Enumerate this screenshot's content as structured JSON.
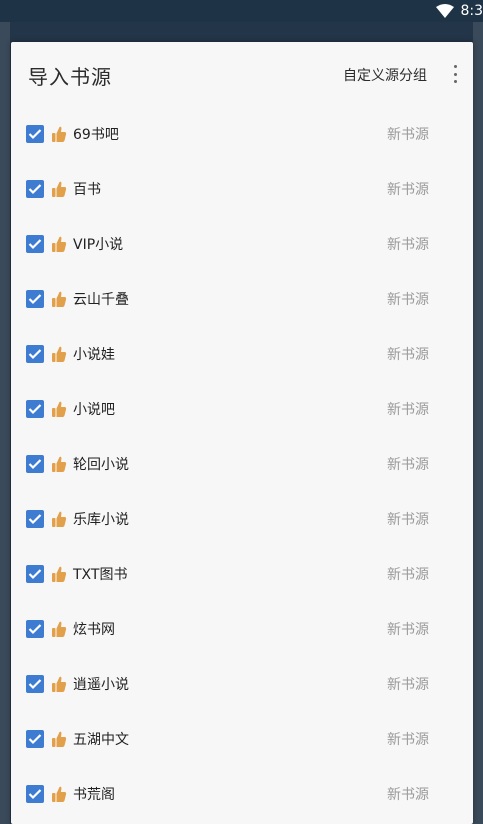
{
  "status_bar": {
    "time": "8:3",
    "wifi_icon": "wifi-icon"
  },
  "dialog": {
    "title": "导入书源",
    "custom_group_label": "自定义源分组",
    "more_icon": "more-vert-icon"
  },
  "colors": {
    "checkbox": "#3d7cd0",
    "thumb": "#e2a04a",
    "status_text": "#9a9a9a"
  },
  "items": [
    {
      "checked": true,
      "icon": "thumbs-up-icon",
      "name": "69书吧",
      "status": "新书源"
    },
    {
      "checked": true,
      "icon": "thumbs-up-icon",
      "name": "百书",
      "status": "新书源"
    },
    {
      "checked": true,
      "icon": "thumbs-up-icon",
      "name": "VIP小说",
      "status": "新书源"
    },
    {
      "checked": true,
      "icon": "thumbs-up-icon",
      "name": "云山千叠",
      "status": "新书源"
    },
    {
      "checked": true,
      "icon": "thumbs-up-icon",
      "name": "小说娃",
      "status": "新书源"
    },
    {
      "checked": true,
      "icon": "thumbs-up-icon",
      "name": "小说吧",
      "status": "新书源"
    },
    {
      "checked": true,
      "icon": "thumbs-up-icon",
      "name": "轮回小说",
      "status": "新书源"
    },
    {
      "checked": true,
      "icon": "thumbs-up-icon",
      "name": "乐库小说",
      "status": "新书源"
    },
    {
      "checked": true,
      "icon": "thumbs-up-icon",
      "name": "TXT图书",
      "status": "新书源"
    },
    {
      "checked": true,
      "icon": "thumbs-up-icon",
      "name": "炫书网",
      "status": "新书源"
    },
    {
      "checked": true,
      "icon": "thumbs-up-icon",
      "name": "逍遥小说",
      "status": "新书源"
    },
    {
      "checked": true,
      "icon": "thumbs-up-icon",
      "name": "五湖中文",
      "status": "新书源"
    },
    {
      "checked": true,
      "icon": "thumbs-up-icon",
      "name": "书荒阁",
      "status": "新书源"
    }
  ]
}
